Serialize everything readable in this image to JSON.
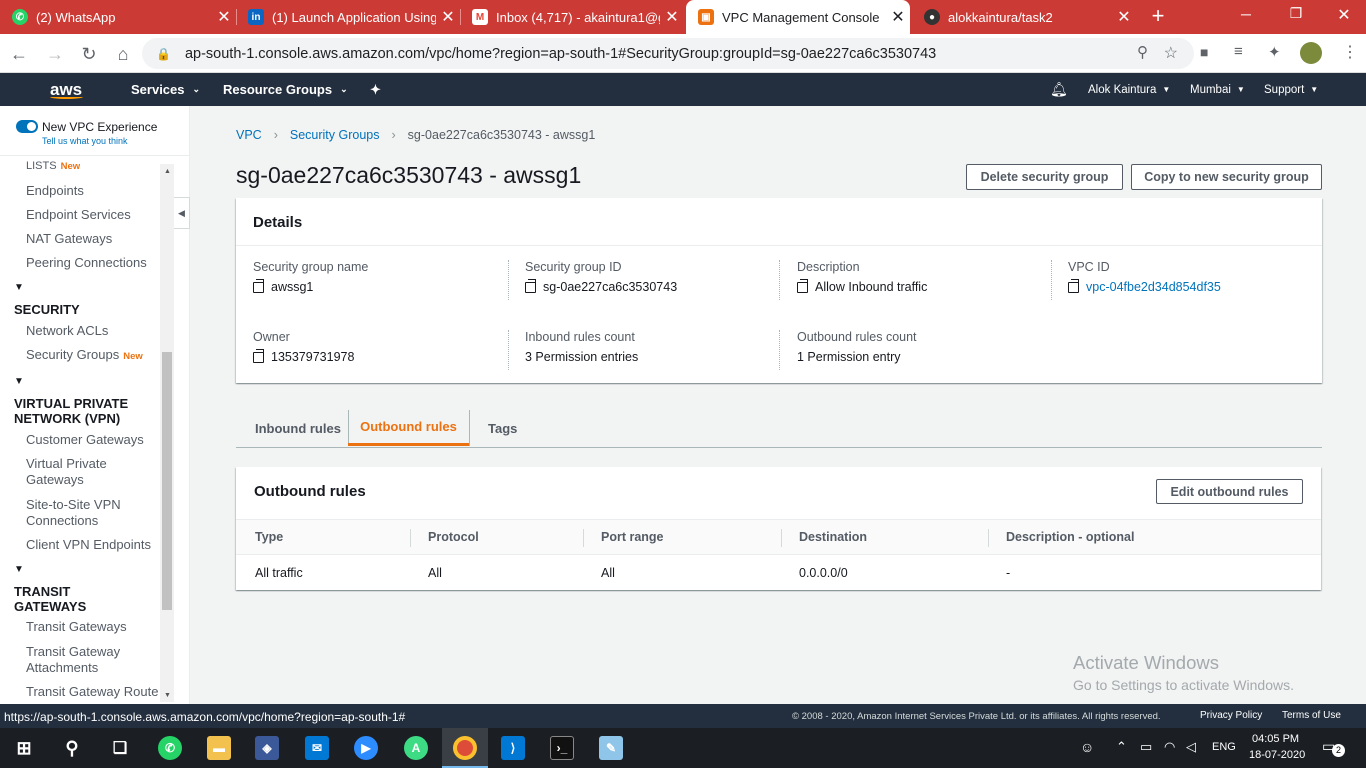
{
  "browser": {
    "tabs": [
      {
        "title": "(2) WhatsApp",
        "icon": "whatsapp-icon",
        "color": "#25d366"
      },
      {
        "title": "(1) Launch Application Using",
        "icon": "linkedin-icon",
        "color": "#0a66c2"
      },
      {
        "title": "Inbox (4,717) - akaintura1@g",
        "icon": "gmail-icon",
        "color": "#ea4335"
      },
      {
        "title": "VPC Management Console",
        "icon": "aws-icon",
        "color": "#ec7211"
      },
      {
        "title": "alokkaintura/task2",
        "icon": "github-icon",
        "color": "#333333"
      }
    ],
    "url": "ap-south-1.console.aws.amazon.com/vpc/home?region=ap-south-1#SecurityGroup:groupId=sg-0ae227ca6c3530743",
    "status_url": "https://ap-south-1.console.aws.amazon.com/vpc/home?region=ap-south-1#"
  },
  "aws_header": {
    "logo": "aws",
    "services": "Services",
    "resource_groups": "Resource Groups",
    "user": "Alok Kaintura",
    "region": "Mumbai",
    "support": "Support"
  },
  "sidebar": {
    "new_vpc_toggle": "New VPC Experience",
    "feedback": "Tell us what you think",
    "top_items": [
      {
        "label": "Lists",
        "new": "New"
      },
      {
        "label": "Endpoints"
      },
      {
        "label": "Endpoint Services"
      },
      {
        "label": "NAT Gateways"
      },
      {
        "label": "Peering Connections"
      }
    ],
    "security_head": "SECURITY",
    "security_items": [
      "Network ACLs",
      "Security Groups"
    ],
    "security_new": "New",
    "vpn_head_1": "VIRTUAL PRIVATE",
    "vpn_head_2": "NETWORK (VPN)",
    "vpn_items": [
      "Customer Gateways",
      "Virtual Private",
      "Gateways",
      "Site-to-Site VPN",
      "Connections",
      "Client VPN Endpoints"
    ],
    "tgw_head_1": "TRANSIT",
    "tgw_head_2": "GATEWAYS",
    "tgw_items": [
      "Transit Gateways",
      "Transit Gateway",
      "Attachments",
      "Transit Gateway Route"
    ]
  },
  "breadcrumb": [
    "VPC",
    "Security Groups",
    "sg-0ae227ca6c3530743 - awssg1"
  ],
  "page_title": "sg-0ae227ca6c3530743 - awssg1",
  "actions": {
    "delete": "Delete security group",
    "copy": "Copy to new security group"
  },
  "details": {
    "heading": "Details",
    "fields": [
      {
        "label": "Security group name",
        "value": "awssg1"
      },
      {
        "label": "Security group ID",
        "value": "sg-0ae227ca6c3530743"
      },
      {
        "label": "Description",
        "value": "Allow Inbound traffic"
      },
      {
        "label": "VPC ID",
        "value": "vpc-04fbe2d34d854df35"
      },
      {
        "label": "Owner",
        "value": "135379731978"
      },
      {
        "label": "Inbound rules count",
        "value": "3 Permission entries"
      },
      {
        "label": "Outbound rules count",
        "value": "1 Permission entry"
      }
    ]
  },
  "tabs": [
    "Inbound rules",
    "Outbound rules",
    "Tags"
  ],
  "active_tab": "Outbound rules",
  "outbound": {
    "heading": "Outbound rules",
    "edit": "Edit outbound rules",
    "columns": [
      "Type",
      "Protocol",
      "Port range",
      "Destination",
      "Description - optional"
    ],
    "rows": [
      [
        "All traffic",
        "All",
        "All",
        "0.0.0.0/0",
        "-"
      ]
    ]
  },
  "watermark": {
    "line1": "Activate Windows",
    "line2": "Go to Settings to activate Windows."
  },
  "footer": {
    "copyright": "© 2008 - 2020, Amazon Internet Services Private Ltd. or its affiliates. All rights reserved.",
    "privacy": "Privacy Policy",
    "terms": "Terms of Use"
  },
  "taskbar": {
    "lang": "ENG",
    "time": "04:05 PM",
    "date": "18-07-2020",
    "notifications": "2"
  }
}
